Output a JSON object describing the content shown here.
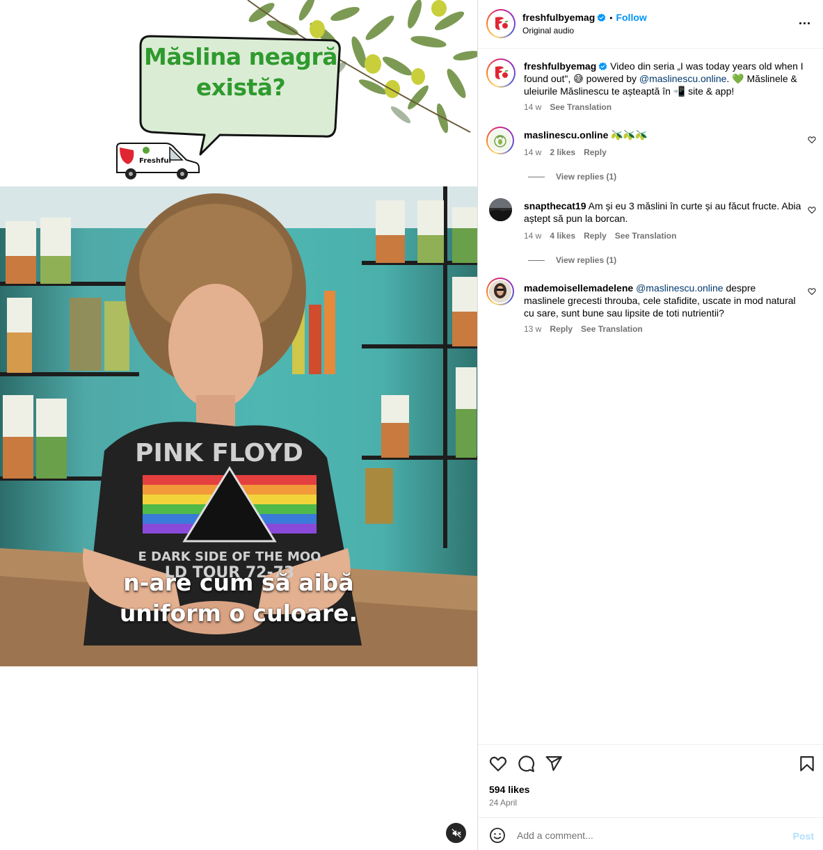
{
  "media": {
    "bubble_line1": "Măslina neagră",
    "bubble_line2": "există?",
    "van_label": "Freshful",
    "shirt_line1": "PINK FLOYD",
    "shirt_line2": "E DARK SIDE OF THE MOO",
    "shirt_line3": "LD TOUR 72-73",
    "caption_line1": "n-are cum să aibă",
    "caption_line2": "uniform o culoare."
  },
  "header": {
    "username": "freshfulbyemag",
    "dot": "•",
    "follow": "Follow",
    "audio": "Original audio"
  },
  "post": {
    "username": "freshfulbyemag",
    "text_before": " Video din seria „I was today years old when I found out\", 😅 powered by ",
    "mention": "@maslinescu.online",
    "text_after": ". 💚 Măslinele & uleiurile Măslinescu te așteaptă în 📲 site & app!",
    "time": "14 w",
    "see_translation": "See Translation"
  },
  "comments": [
    {
      "username": "maslinescu.online",
      "text": " 🫒🫒🫒",
      "time": "14 w",
      "likes": "2 likes",
      "reply": "Reply",
      "view_replies": "View replies (1)"
    },
    {
      "username": "snapthecat19",
      "text": " Am și eu 3 măslini în curte și au făcut fructe. Abia aștept să pun la borcan.",
      "time": "14 w",
      "likes": "4 likes",
      "reply": "Reply",
      "see_translation": "See Translation",
      "view_replies": "View replies (1)"
    },
    {
      "username": "mademoisellemadelene",
      "mention": "@maslinescu.online",
      "text": " despre maslinele grecesti throuba, cele stafidite, uscate in mod natural cu sare, sunt bune sau lipsite de toti nutrientii?",
      "time": "13 w",
      "reply": "Reply",
      "see_translation": "See Translation"
    }
  ],
  "footer": {
    "likes": "594 likes",
    "date": "24 April",
    "comment_placeholder": "Add a comment...",
    "post_label": "Post"
  },
  "icons": {
    "like": "heart-icon",
    "comment": "comment-icon",
    "share": "send-icon",
    "save": "bookmark-icon",
    "emoji": "emoji-icon",
    "mute": "speaker-muted-icon",
    "more": "more-options-icon",
    "verified": "verified-badge-icon"
  },
  "colors": {
    "accent": "#0095f6",
    "mention": "#00376b",
    "muted_text": "#737373",
    "bubble_text": "#2f9a2e",
    "post_disabled": "#b2dffc"
  }
}
